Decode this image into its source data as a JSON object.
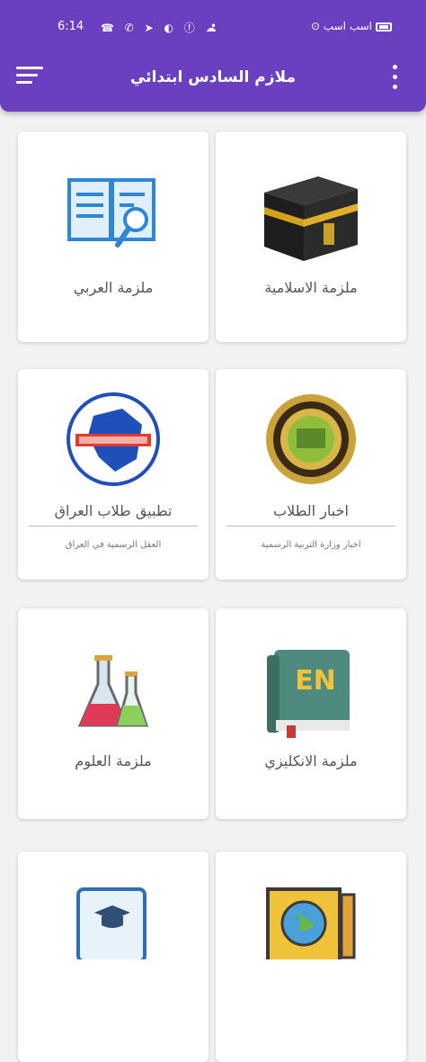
{
  "status_bar": {
    "time": "6:14",
    "notifications": "☎ ✆ ➤ ◐ ⓕ ☁",
    "dot": "•",
    "carrier": "⊙ اسب اسب"
  },
  "header": {
    "title": "ملازم السادس ابتدائي"
  },
  "cards": [
    {
      "title": "ملزمة الاسلامية",
      "icon": "kaaba-icon"
    },
    {
      "title": "ملزمة العربي",
      "icon": "book-magnifier-icon"
    },
    {
      "title": "اخبار الطلاب",
      "subtitle": "اخبار وزارة التربية الرسمية",
      "icon": "ministry-seal-icon"
    },
    {
      "title": "تطبيق طلاب العراق",
      "subtitle": "العقل الرسمية في العراق",
      "icon": "iraq-map-logo-icon"
    },
    {
      "title": "ملزمة الانكليزي",
      "icon": "english-book-icon",
      "icon_text": "EN"
    },
    {
      "title": "ملزمة العلوم",
      "icon": "flasks-icon"
    },
    {
      "title": "",
      "icon": "globe-book-icon"
    },
    {
      "title": "",
      "icon": "graduation-tablet-icon"
    }
  ],
  "colors": {
    "appbar": "#6a3fc0",
    "background": "#f2f2f2"
  }
}
